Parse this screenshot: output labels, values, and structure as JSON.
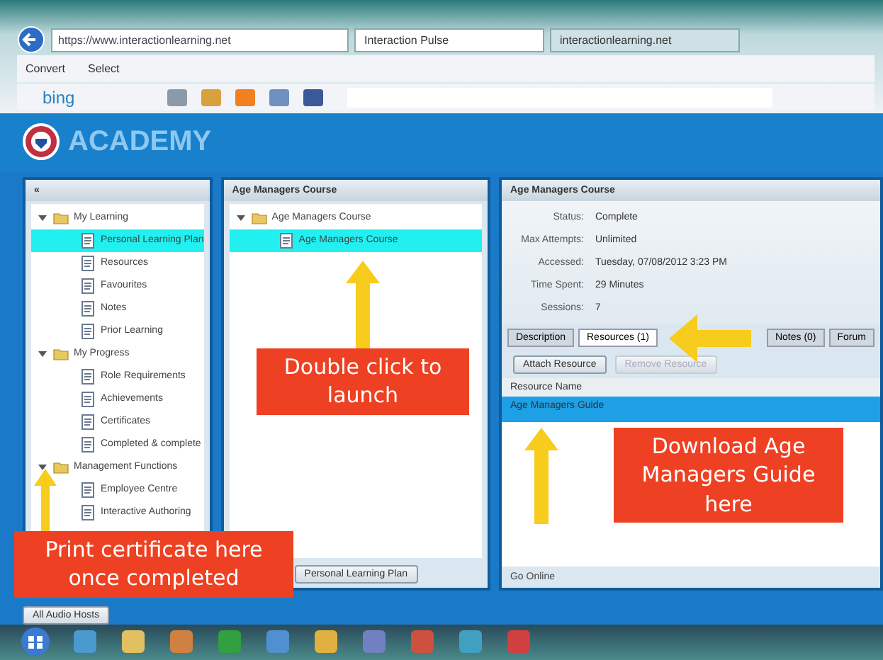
{
  "browser": {
    "tabs": [
      {
        "title": "Interaction Pulse",
        "selected": true
      },
      {
        "title": "interactionlearning.net",
        "selected": false
      }
    ],
    "address": "https://www.interactionlearning.net",
    "toolbar": [
      "Convert",
      "Select"
    ],
    "search_brand": "bing"
  },
  "app": {
    "logo_text": "ACADEMY"
  },
  "left_panel": {
    "collapse_glyph": "«",
    "tree": [
      {
        "label": "My Learning",
        "expanded": true,
        "children": [
          {
            "label": "Personal Learning Plan",
            "selected": true
          },
          {
            "label": "Resources",
            "selected": false
          },
          {
            "label": "Favourites",
            "selected": false
          },
          {
            "label": "Notes",
            "selected": false
          },
          {
            "label": "Prior Learning",
            "selected": false
          }
        ]
      },
      {
        "label": "My Progress",
        "expanded": true,
        "children": [
          {
            "label": "Role Requirements",
            "selected": false
          },
          {
            "label": "Achievements",
            "selected": false
          },
          {
            "label": "Certificates",
            "selected": false
          },
          {
            "label": "Completed & complete",
            "selected": false
          }
        ]
      },
      {
        "label": "Management Functions",
        "expanded": true,
        "children": [
          {
            "label": "Employee Centre",
            "selected": false
          },
          {
            "label": "Interactive Authoring",
            "selected": false
          }
        ]
      }
    ]
  },
  "middle_panel": {
    "title": "Age Managers Course",
    "tree": [
      {
        "label": "Age Managers Course",
        "expanded": true,
        "children": [
          {
            "label": "Age Managers Course",
            "selected": true
          }
        ]
      }
    ],
    "footer_button": "Personal Learning Plan"
  },
  "right_panel": {
    "title": "Age Managers Course",
    "fields": [
      {
        "label": "Status:",
        "value": "Complete"
      },
      {
        "label": "Max Attempts:",
        "value": "Unlimited"
      },
      {
        "label": "Accessed:",
        "value": "Tuesday, 07/08/2012 3:23 PM"
      },
      {
        "label": "Time Spent:",
        "value": "29 Minutes"
      },
      {
        "label": "Sessions:",
        "value": "7"
      }
    ],
    "tabs": [
      {
        "label": "Description",
        "selected": false
      },
      {
        "label": "Resources (1)",
        "selected": true
      },
      {
        "label": "Notes (0)",
        "selected": false
      },
      {
        "label": "Forum",
        "selected": false
      }
    ],
    "buttons": [
      {
        "label": "Attach Resource",
        "disabled": false
      },
      {
        "label": "Remove Resource",
        "disabled": true
      }
    ],
    "column": "Resource Name",
    "rows": [
      {
        "name": "Age Managers Guide",
        "selected": true
      }
    ],
    "footer_label": "Go Online"
  },
  "bottom_bar": {
    "button": "All Audio Hosts"
  },
  "callouts": [
    "Double click to launch",
    "Download Age Managers Guide here",
    "Print certificate here once completed"
  ]
}
